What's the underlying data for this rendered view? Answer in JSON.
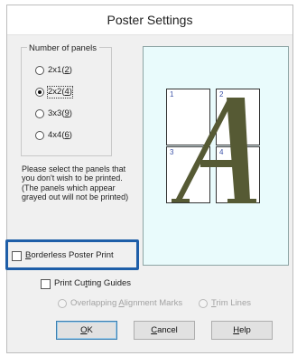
{
  "dialog": {
    "title": "Poster Settings"
  },
  "panels_group": {
    "title": "Number of panels",
    "options": [
      {
        "label_prefix": "2x1(",
        "accel": "2",
        "label_suffix": ")",
        "selected": false
      },
      {
        "label_prefix": "2x2(",
        "accel": "4",
        "label_suffix": ")",
        "selected": true
      },
      {
        "label_prefix": "3x3(",
        "accel": "9",
        "label_suffix": ")",
        "selected": false
      },
      {
        "label_prefix": "4x4(",
        "accel": "6",
        "label_suffix": ")",
        "selected": false
      }
    ]
  },
  "instructions": "Please select the panels that you don't wish to be printed. (The panels which appear grayed out will not be printed)",
  "preview": {
    "panels": [
      "1",
      "2",
      "3",
      "4"
    ],
    "glyph": "A",
    "glyph_color": "#565a34",
    "background": "#e9fbfc"
  },
  "borderless": {
    "accel": "B",
    "rest": "orderless Poster Print",
    "checked": false,
    "highlight_color": "#1e5ea8"
  },
  "cutting_guides": {
    "pre": "Print Cu",
    "accel": "t",
    "post": "ting Guides",
    "checked": false
  },
  "guide_options": {
    "overlap": {
      "pre": "Overlapping ",
      "accel": "A",
      "post": "lignment Marks",
      "enabled": false
    },
    "trim": {
      "accel": "T",
      "post": "rim Lines",
      "enabled": false
    }
  },
  "buttons": {
    "ok": {
      "accel": "O",
      "rest": "K"
    },
    "cancel": {
      "accel": "C",
      "rest": "ancel"
    },
    "help": {
      "accel": "H",
      "rest": "elp"
    }
  }
}
